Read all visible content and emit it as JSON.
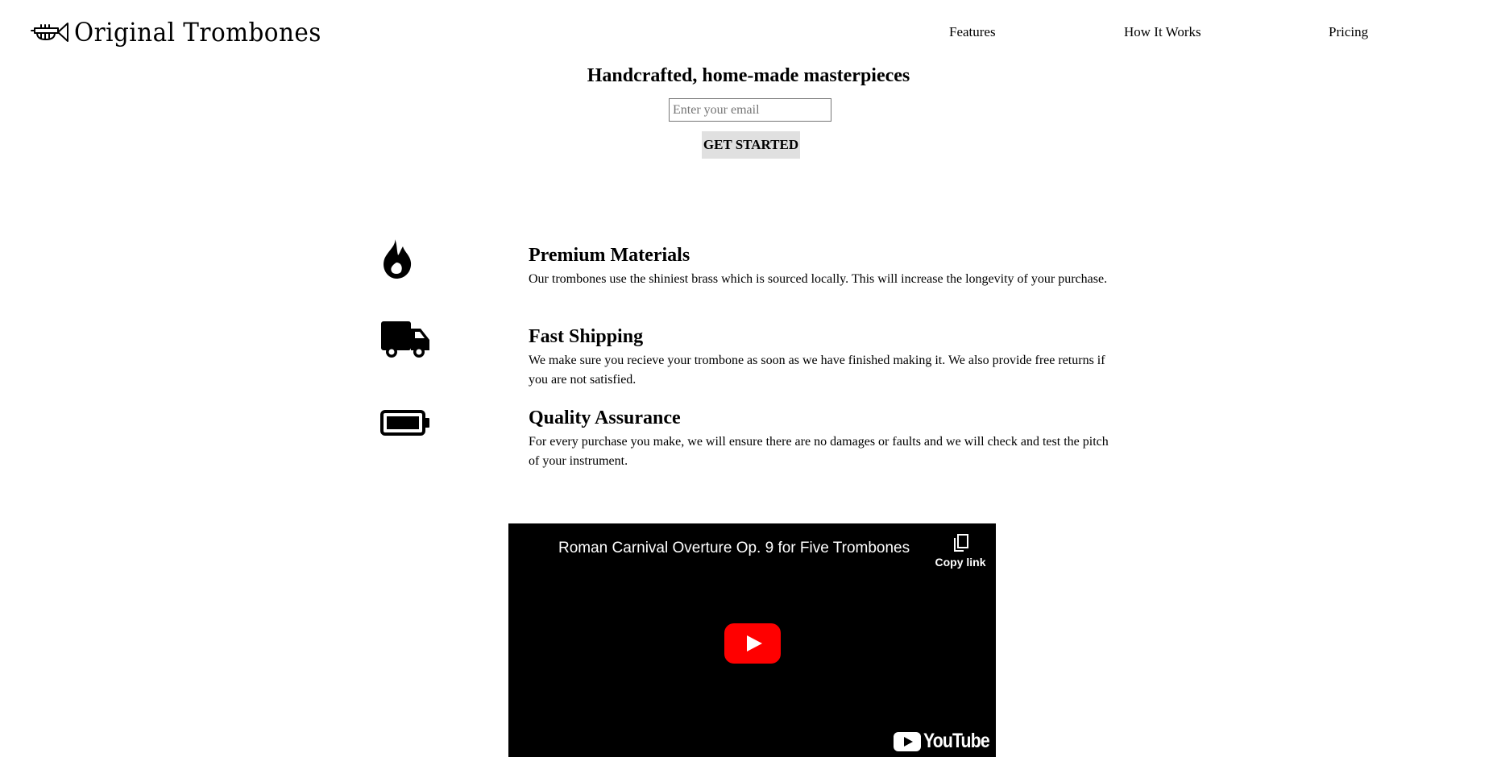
{
  "header": {
    "brand": "Original Trombones",
    "nav": [
      {
        "label": "Features"
      },
      {
        "label": "How It Works"
      },
      {
        "label": "Pricing"
      }
    ]
  },
  "hero": {
    "title": "Handcrafted, home-made masterpieces",
    "email_placeholder": "Enter your email",
    "cta_label": "GET STARTED"
  },
  "features": [
    {
      "icon": "fire-icon",
      "title": "Premium Materials",
      "description": "Our trombones use the shiniest brass which is sourced locally. This will increase the longevity of your purchase."
    },
    {
      "icon": "truck-icon",
      "title": "Fast Shipping",
      "description": "We make sure you recieve your trombone as soon as we have finished making it. We also provide free returns if you are not satisfied."
    },
    {
      "icon": "battery-full-icon",
      "title": "Quality Assurance",
      "description": "For every purchase you make, we will ensure there are no damages or faults and we will check and test the pitch of your instrument."
    }
  ],
  "video": {
    "title": "Roman Carnival Overture Op. 9 for Five Trombones",
    "copy_link_label": "Copy link",
    "logo_text": "YouTube"
  },
  "colors": {
    "button_bg": "#e0e0e0",
    "video_bg": "#000000",
    "play_red": "#ff0000"
  }
}
